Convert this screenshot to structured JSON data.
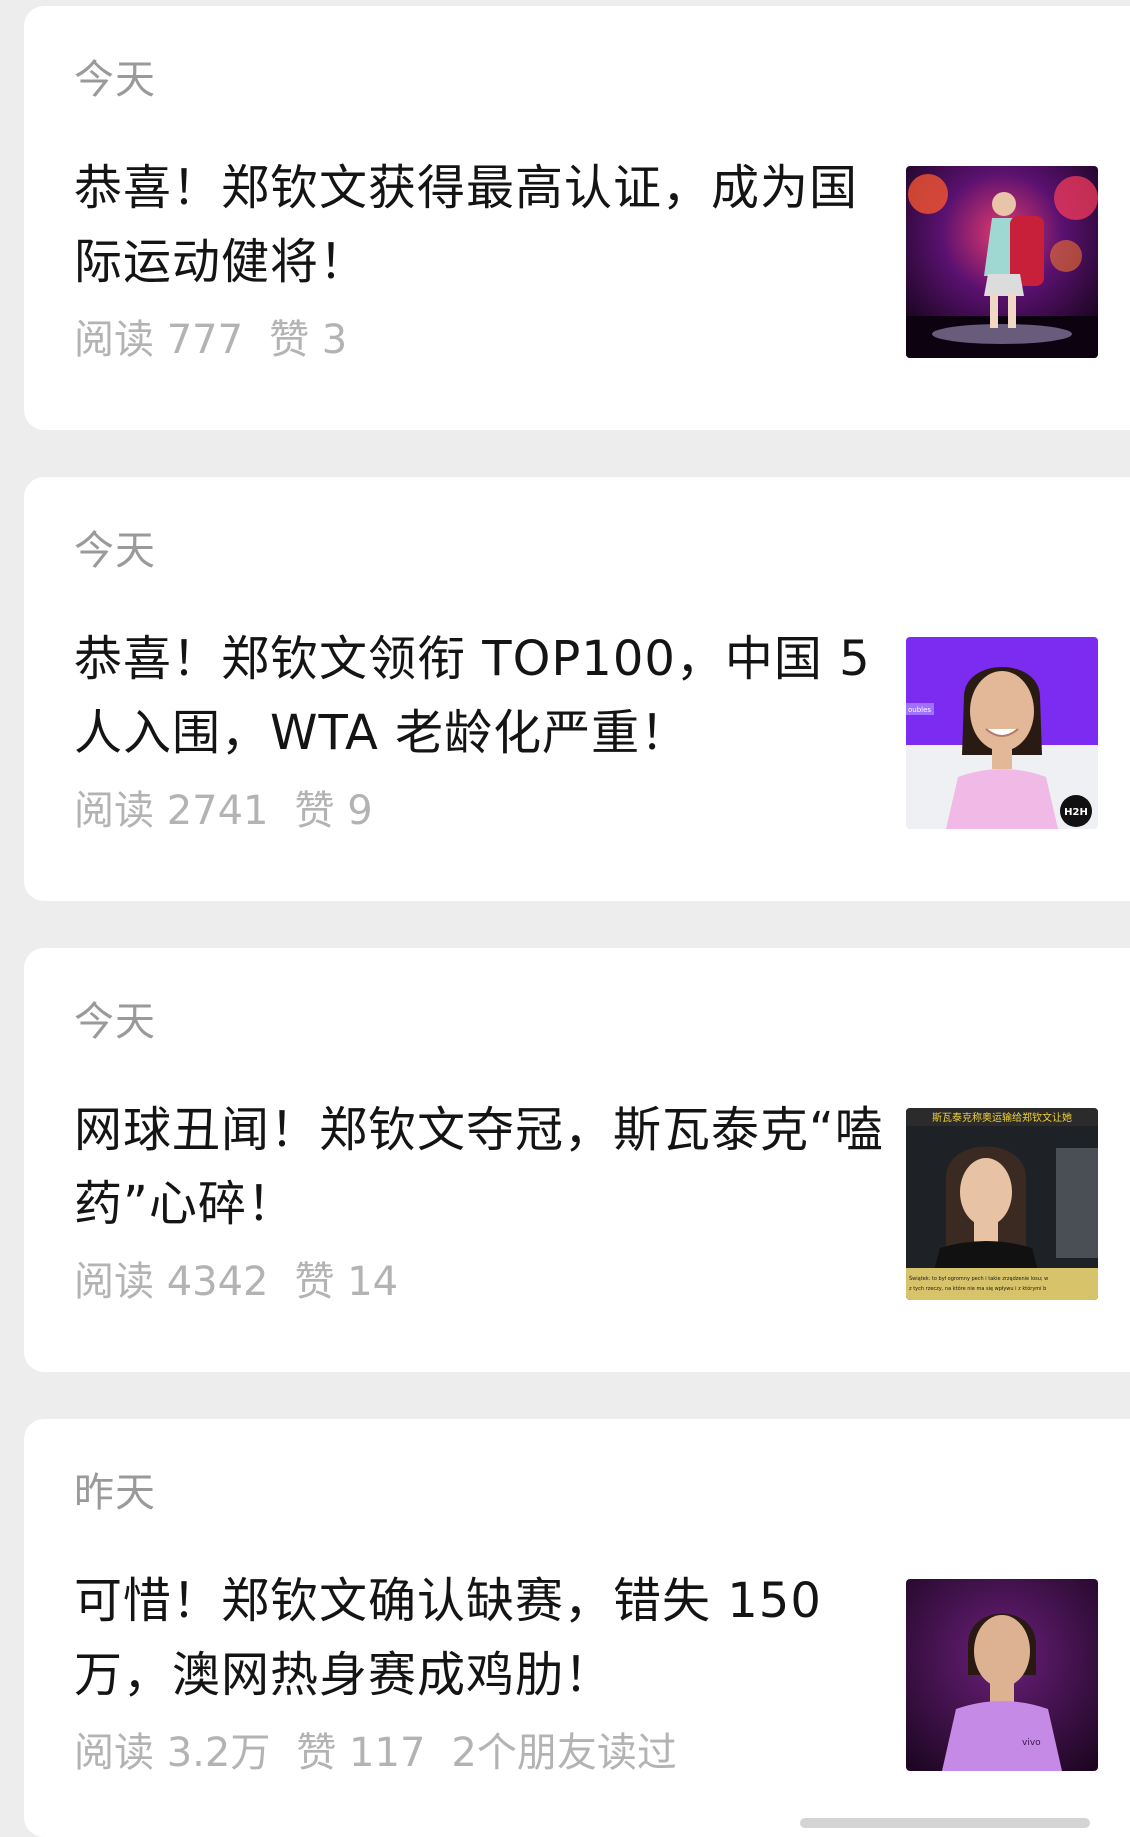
{
  "articles": [
    {
      "date": "今天",
      "title": "恭喜！郑钦文获得最高认证，成为国际运动健将！",
      "reads": "阅读 777",
      "likes": "赞 3",
      "friends": "",
      "thumbnail": "tennis-player-stage-walkout-image"
    },
    {
      "date": "今天",
      "title": "恭喜！郑钦文领衔 TOP100，中国 5 人入围，WTA 老龄化严重！",
      "reads": "阅读 2741",
      "likes": "赞 9",
      "friends": "",
      "thumbnail": "smiling-player-portrait-image",
      "thumbnail_text": {
        "tag": "oubles",
        "badge": "H2H"
      }
    },
    {
      "date": "今天",
      "title": "网球丑闻！郑钦文夺冠，斯瓦泰克“嗑药”心碎！",
      "reads": "阅读 4342",
      "likes": "赞 14",
      "friends": "",
      "thumbnail": "interview-screenshot-image",
      "thumbnail_text": {
        "caption_top": "斯瓦泰克称奥运输给郑钦文让她",
        "caption_bottom_1": "Świątek: to był ogromny pech i takie zrządzenie losu; w",
        "caption_bottom_2": "z tych rzeczy, na które nie ma się wpływu i z którymi b"
      }
    },
    {
      "date": "昨天",
      "title": "可惜！郑钦文确认缺赛，错失 150 万，澳网热身赛成鸡肋！",
      "reads": "阅读 3.2万",
      "likes": "赞 117",
      "friends": "2个朋友读过",
      "thumbnail": "player-purple-outfit-image",
      "thumbnail_text": {
        "brand": "vivo"
      }
    }
  ],
  "colors": {
    "background": "#ededed",
    "card": "#ffffff",
    "title": "#141414",
    "date": "#9a9a9a",
    "meta": "#b3b3b3"
  }
}
